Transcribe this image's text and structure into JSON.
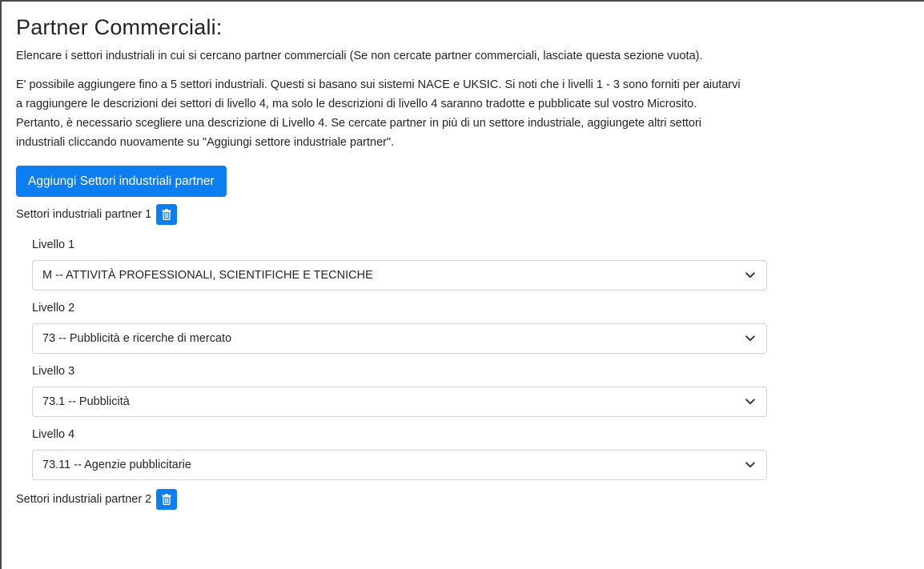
{
  "section": {
    "title": "Partner Commerciali:",
    "intro": "Elencare i settori industriali in cui si cercano partner commerciali (Se non cercate partner commerciali, lasciate questa sezione vuota).",
    "description_lines": [
      "E' possibile aggiungere fino a 5 settori industriali. Questi si basano sui sistemi NACE e UKSIC. Si noti che i livelli 1 - 3 sono forniti per aiutarvi",
      "a raggiungere le descrizioni dei settori di livello 4, ma solo le descrizioni di livello 4 saranno tradotte e pubblicate sul vostro Microsito.",
      "Pertanto, è necessario scegliere una descrizione di Livello 4. Se cercate partner in più di un settore industriale, aggiungete altri settori",
      "industriali cliccando nuovamente su \"Aggiungi settore industriale partner\"."
    ],
    "add_button_label": "Aggiungi Settori industriali partner"
  },
  "partners": [
    {
      "label": "Settori industriali partner 1",
      "levels": [
        {
          "label": "Livello 1",
          "value": "M -- ATTIVITÀ PROFESSIONALI, SCIENTIFICHE E TECNICHE"
        },
        {
          "label": "Livello 2",
          "value": "73 -- Pubblicità e ricerche di mercato"
        },
        {
          "label": "Livello 3",
          "value": "73.1 -- Pubblicità"
        },
        {
          "label": "Livello 4",
          "value": "73.11 -- Agenzie pubblicitarie"
        }
      ]
    },
    {
      "label": "Settori industriali partner 2"
    }
  ],
  "icons": {
    "delete": "trash-icon",
    "dropdown": "chevron-down-icon"
  },
  "colors": {
    "primary": "#0d7ef2",
    "text": "#212529",
    "border": "#ced4da"
  }
}
